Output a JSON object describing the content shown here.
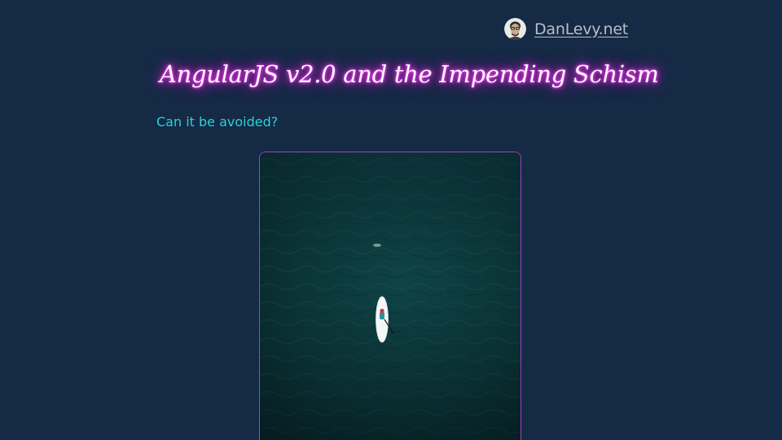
{
  "header": {
    "site_name": "DanLevy.net",
    "avatar_icon": "avatar-icon"
  },
  "post": {
    "title": "AngularJS v2.0 and the Impending Schism",
    "subtitle": "Can it be avoided?"
  },
  "colors": {
    "background": "#152a45",
    "title_glow": "#e62ee6",
    "subtitle": "#2bd1da",
    "frame_border": "#a43fc2",
    "water": "#0b3a3c"
  },
  "hero_image": {
    "subject": "paddleboard-on-ocean"
  }
}
